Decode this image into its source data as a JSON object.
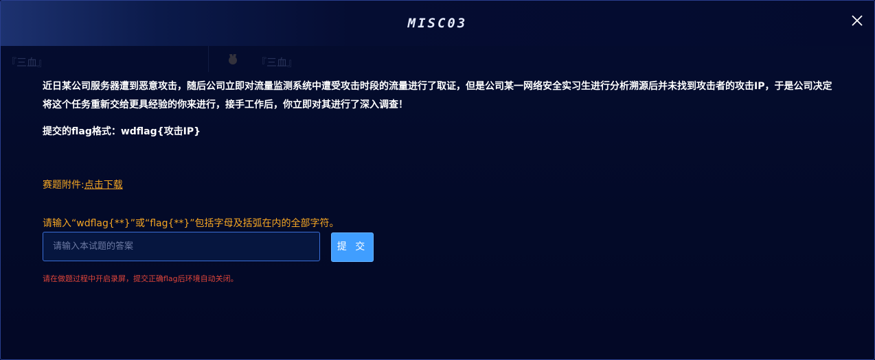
{
  "dialog": {
    "title": "MISC03",
    "close_icon": "close-icon"
  },
  "background_row": {
    "left_text": "『三血』",
    "right_text": "『三血』",
    "icon": "medal-icon"
  },
  "challenge": {
    "description": "近日某公司服务器遭到恶意攻击，随后公司立即对流量监测系统中遭受攻击时段的流量进行了取证，但是公司某一网络安全实习生进行分析溯源后并未找到攻击者的攻击IP，于是公司决定将这个任务重新交给更具经验的你来进行，接手工作后，你立即对其进行了深入调查！",
    "flag_format": "提交的flag格式：wdflag{攻击IP}",
    "attachment_label": "赛题附件:",
    "attachment_link": "点击下载",
    "input_hint": "请输入“wdflag{**}”或“flag{**}”包括字母及括弧在内的全部字符。",
    "answer_placeholder": "请输入本试题的答案",
    "answer_value": "",
    "submit_label": "提 交",
    "warning": "请在做题过程中开启录屏，提交正确flag后环境自动关闭。"
  },
  "colors": {
    "background": "#040b2c",
    "accent_orange": "#f5a623",
    "button_blue": "#409eff",
    "warning_red": "#e0453a",
    "input_border": "#3a6fd8"
  }
}
